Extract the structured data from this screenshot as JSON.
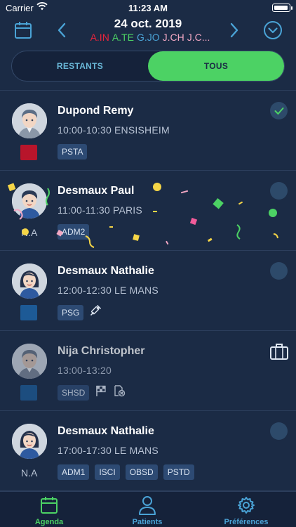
{
  "status_bar": {
    "carrier": "Carrier",
    "time": "11:23 AM"
  },
  "header": {
    "date": "24 oct. 2019",
    "initials": [
      {
        "text": "A.IN",
        "color": "#e8243c"
      },
      {
        "text": "A.TE",
        "color": "#4cd264"
      },
      {
        "text": "G.JO",
        "color": "#4aa3d6"
      },
      {
        "text": "J.CH",
        "color": "#f2a7c3"
      },
      {
        "text": "J.C...",
        "color": "#f2a7c3"
      }
    ]
  },
  "segment": {
    "restants": "RESTANTS",
    "tous": "TOUS",
    "selected": "TOUS"
  },
  "appointments": [
    {
      "name": "Dupond Remy",
      "time": "10:00-10:30 ENSISHEIM",
      "tags": [
        "PSTA"
      ],
      "color": "#b8152b",
      "status": "done",
      "avatar": "man"
    },
    {
      "name": "Desmaux Paul",
      "time": "11:00-11:30 PARIS",
      "tags": [
        "ADM2"
      ],
      "side_label": "N.A",
      "status": "pending",
      "avatar": "boy"
    },
    {
      "name": "Desmaux Nathalie",
      "time": "12:00-12:30 LE MANS",
      "tags": [
        "PSG"
      ],
      "color": "#1d5a96",
      "status": "pending",
      "avatar": "woman",
      "extra_icons": [
        "syringe-icon"
      ]
    },
    {
      "name": "Nija Christopher",
      "time": "13:00-13:20",
      "tags": [
        "SHSD"
      ],
      "color": "#1d5a96",
      "status": "briefcase",
      "avatar": "man-grey",
      "extra_icons": [
        "flag-icon",
        "file-cancel-icon"
      ]
    },
    {
      "name": "Desmaux Nathalie",
      "time": "17:00-17:30 LE MANS",
      "tags": [
        "ADM1",
        "ISCI",
        "OBSD",
        "PSTD"
      ],
      "side_label": "N.A",
      "status": "pending",
      "avatar": "woman"
    }
  ],
  "tabbar": {
    "agenda": "Agenda",
    "patients": "Patients",
    "preferences": "Préférences",
    "active": "Agenda"
  },
  "colors": {
    "background": "#1b2b45",
    "accent_green": "#4cd264",
    "accent_blue": "#4aa3d6",
    "tag_bg": "#2d4a73"
  }
}
